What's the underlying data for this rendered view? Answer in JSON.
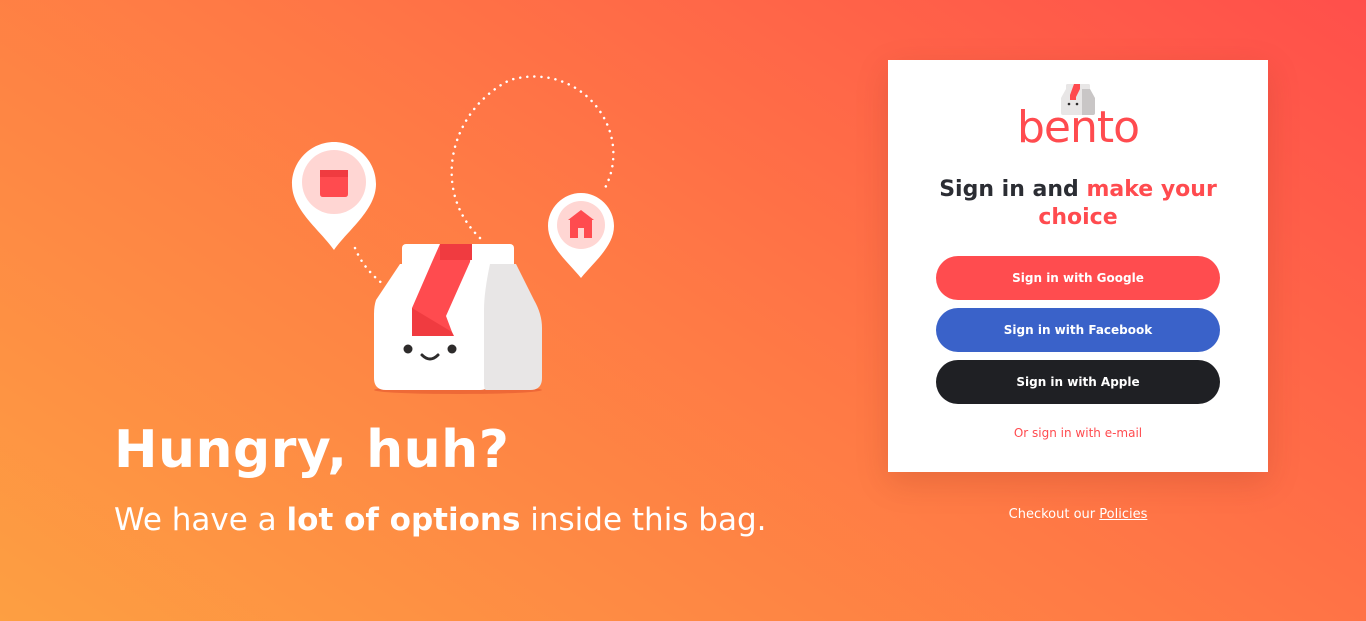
{
  "colors": {
    "accent": "#ff4b4f",
    "google": "#ff4c4f",
    "facebook": "#3a62c9",
    "apple": "#1f2024",
    "background_start": "#fd9f42",
    "background_end": "#ff4f4b"
  },
  "hero": {
    "title": "Hungry, huh?",
    "subtitle_pre": "We have a ",
    "subtitle_bold": "lot of options",
    "subtitle_post": " inside this bag."
  },
  "illustration": {
    "icons": [
      "bag-mascot-icon",
      "location-pin-icon",
      "store-icon",
      "shop-icon",
      "dotted-path-icon"
    ]
  },
  "card": {
    "logo_text": "bento",
    "headline_part1": "Sign in and ",
    "headline_accent": "make your choice",
    "google_button": "Sign in with Google",
    "facebook_button": "Sign in with Facebook",
    "apple_button": "Sign in with Apple",
    "email_link": "Or sign in with e-mail"
  },
  "footer": {
    "policies_prefix": "Checkout our ",
    "policies_link": "Policies"
  }
}
